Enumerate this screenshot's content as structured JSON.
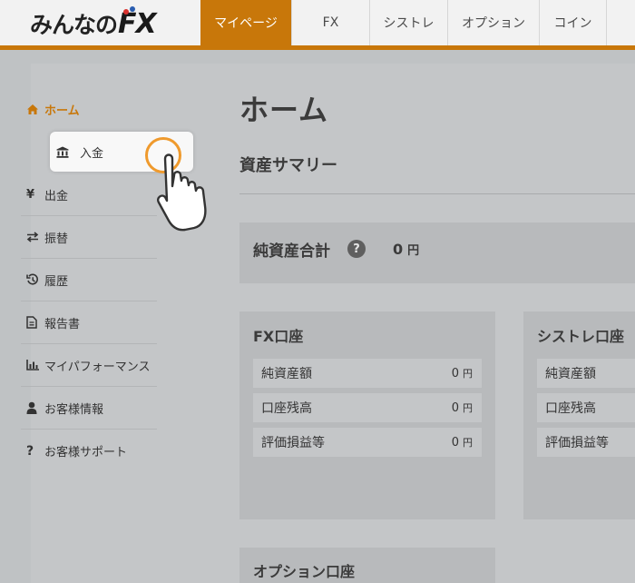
{
  "header": {
    "logo_kana": "みんなの",
    "logo_fx": "FX",
    "nav": [
      {
        "label": "マイページ",
        "active": true
      },
      {
        "label": "FX",
        "active": false
      },
      {
        "label": "シストレ",
        "active": false
      },
      {
        "label": "オプション",
        "active": false
      },
      {
        "label": "コイン",
        "active": false
      }
    ]
  },
  "sidebar": {
    "items": [
      {
        "label": "ホーム",
        "icon": "home-icon"
      },
      {
        "label": "入金",
        "icon": "bank-icon"
      },
      {
        "label": "出金",
        "icon": "yen-icon"
      },
      {
        "label": "振替",
        "icon": "transfer-icon"
      },
      {
        "label": "履歴",
        "icon": "history-icon"
      },
      {
        "label": "報告書",
        "icon": "document-icon"
      },
      {
        "label": "マイパフォーマンス",
        "icon": "chart-icon"
      },
      {
        "label": "お客様情報",
        "icon": "user-icon"
      },
      {
        "label": "お客様サポート",
        "icon": "question-icon"
      }
    ]
  },
  "main": {
    "title": "ホーム",
    "summary_title": "資産サマリー",
    "net_assets": {
      "label": "純資産合計",
      "value": "0",
      "unit": "円"
    },
    "fx_account": {
      "title": "FX口座",
      "rows": [
        {
          "label": "純資産額",
          "value": "0",
          "unit": "円"
        },
        {
          "label": "口座残高",
          "value": "0",
          "unit": "円"
        },
        {
          "label": "評価損益等",
          "value": "0",
          "unit": "円"
        }
      ]
    },
    "systre_account": {
      "title": "シストレ口座",
      "rows": [
        {
          "label": "純資産額"
        },
        {
          "label": "口座残高"
        },
        {
          "label": "評価損益等"
        }
      ]
    },
    "option_account": {
      "title": "オプション口座"
    }
  },
  "colors": {
    "accent": "#c8770a",
    "pointer_ring": "#ef9a2d"
  }
}
